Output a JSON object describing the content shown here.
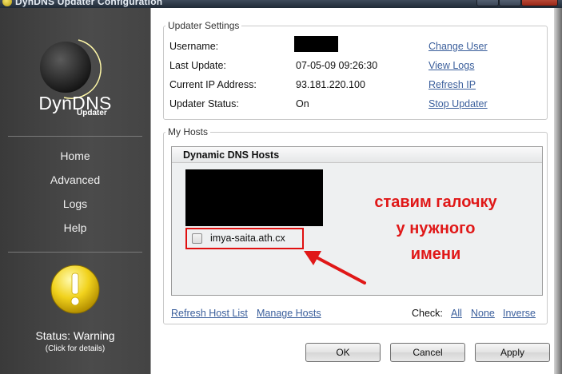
{
  "window": {
    "title": "DynDNS Updater Configuration"
  },
  "sidebar": {
    "brand": "DynDNS",
    "brand_sub": "Updater",
    "nav": [
      {
        "label": "Home"
      },
      {
        "label": "Advanced"
      },
      {
        "label": "Logs"
      },
      {
        "label": "Help"
      }
    ],
    "status": "Status: Warning",
    "status_hint": "(Click for details)"
  },
  "updater_settings": {
    "legend": "Updater Settings",
    "username_label": "Username:",
    "last_update_label": "Last Update:",
    "last_update_value": "07-05-09 09:26:30",
    "current_ip_label": "Current IP Address:",
    "current_ip_value": "93.181.220.100",
    "status_label": "Updater Status:",
    "status_value": "On",
    "links": {
      "change_user": "Change User",
      "view_logs": "View Logs",
      "refresh_ip": "Refresh IP",
      "stop_updater": "Stop Updater"
    }
  },
  "my_hosts": {
    "legend": "My Hosts",
    "list_title": "Dynamic DNS Hosts",
    "host": {
      "name": "imya-saita.ath.cx",
      "checked": false
    },
    "refresh_link": "Refresh Host List",
    "manage_link": "Manage Hosts",
    "check_label": "Check:",
    "check_all": "All",
    "check_none": "None",
    "check_inverse": "Inverse"
  },
  "annotation": {
    "lines": [
      "ставим галочку",
      "у нужного",
      "имени"
    ],
    "color": "#e01818"
  },
  "buttons": {
    "ok": "OK",
    "cancel": "Cancel",
    "apply": "Apply"
  }
}
